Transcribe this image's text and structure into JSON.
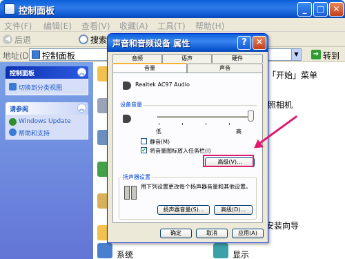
{
  "window": {
    "title": "控制面板",
    "controls": {
      "minimize": "_",
      "maximize": "□",
      "close": "✕"
    }
  },
  "menubar": {
    "items": [
      "文件(F)",
      "编辑(E)",
      "查看(V)",
      "收藏(A)",
      "工具(T)",
      "帮助(H)"
    ]
  },
  "toolbar": {
    "back_label": "后退",
    "search_label": "搜索"
  },
  "addressbar": {
    "label": "地址(D)",
    "value": "控制面板",
    "go_label": "转到"
  },
  "leftpane": {
    "panel_box": {
      "title": "控制面板",
      "links": [
        "切换到分类视图"
      ]
    },
    "see_also_box": {
      "title": "请参阅",
      "links": [
        "Windows Update",
        "帮助和支持"
      ]
    }
  },
  "content": {
    "partial_texts": {
      "start_menu": "「开始」菜单",
      "camera": "照相机",
      "wizard": "安装向导",
      "system": "系统",
      "display": "显示"
    }
  },
  "dialog": {
    "title": "声音和音频设备 属性",
    "help": "?",
    "close": "✕",
    "tabs_row1": [
      "音频",
      "语声",
      "硬件"
    ],
    "tabs_row2": [
      "音量",
      "声音"
    ],
    "selected_tab": "音量",
    "device_name": "Realtek AC97 Audio",
    "volume_group": {
      "label": "设备音量",
      "low": "低",
      "high": "高",
      "level": 1.0
    },
    "mute_label": "静音(M)",
    "mute_checked": false,
    "tray_label": "将音量图标放入任务栏(I)",
    "tray_checked": true,
    "advanced_button": "高级(V)...",
    "speaker_group": {
      "label": "扬声器设置",
      "description": "用下列设置更改每个扬声器音量和其他设置。",
      "speaker_volume_button": "扬声器音量(S)...",
      "advanced_button": "高级(D)..."
    },
    "ok_button": "确定",
    "cancel_button": "取消",
    "apply_button": "应用(A)"
  },
  "annotation_color": "#e0186e"
}
